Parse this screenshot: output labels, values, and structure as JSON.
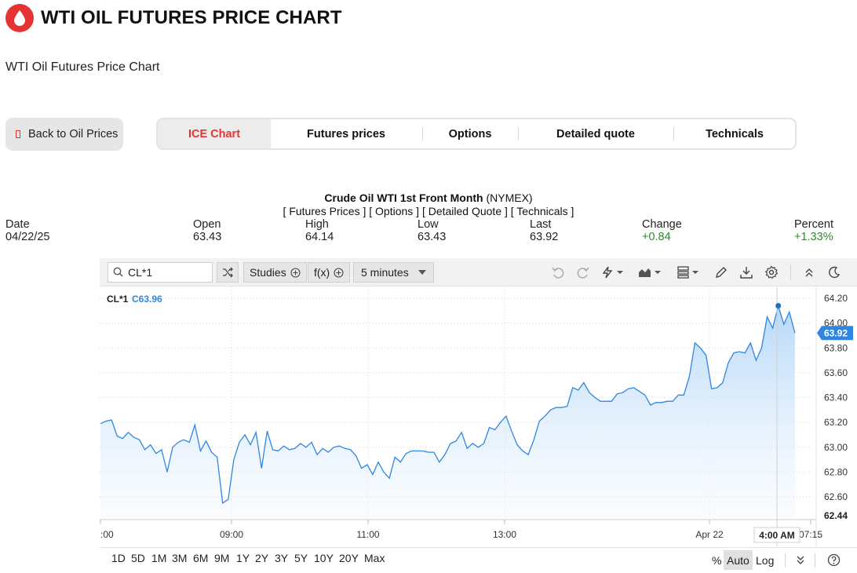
{
  "header": {
    "title": "WTI OIL FUTURES PRICE CHART",
    "subtitle": "WTI Oil Futures Price Chart",
    "brand_color": "#e53232"
  },
  "back_button": {
    "label": "Back to Oil Prices"
  },
  "tabs": [
    {
      "label": "ICE Chart",
      "active": true
    },
    {
      "label": "Futures prices",
      "active": false
    },
    {
      "label": "Options",
      "active": false
    },
    {
      "label": "Detailed quote",
      "active": false
    },
    {
      "label": "Technicals",
      "active": false
    }
  ],
  "quote": {
    "instrument": "Crude Oil WTI 1st Front Month",
    "exchange": "(NYMEX)",
    "links": "[ Futures Prices ] [ Options ] [ Detailed Quote ] [ Technicals ]",
    "columns": [
      {
        "label": "Date",
        "value": "04/22/25"
      },
      {
        "label": "Open",
        "value": "63.43"
      },
      {
        "label": "High",
        "value": "64.14"
      },
      {
        "label": "Low",
        "value": "63.43"
      },
      {
        "label": "Last",
        "value": "63.92"
      },
      {
        "label": "Change",
        "value": "+0.84"
      },
      {
        "label": "Percent",
        "value": "+1.33%"
      }
    ]
  },
  "toolbar": {
    "symbol": "CL*1",
    "studies_label": "Studies",
    "fx_label": "f(x)",
    "interval_label": "5 minutes"
  },
  "chart_data": {
    "type": "area",
    "symbol_label": "CL*1",
    "symbol_value": "C63.96",
    "last_value_label": "63.92",
    "min_label": "62.44",
    "line_color": "#2f86e0",
    "y_ticks": [
      "64.20",
      "64.00",
      "63.80",
      "63.60",
      "63.40",
      "63.20",
      "63.00",
      "62.80",
      "62.60"
    ],
    "y_tick_values": [
      64.2,
      64.0,
      63.8,
      63.6,
      63.4,
      63.2,
      63.0,
      62.8,
      62.6
    ],
    "ylim": [
      62.44,
      64.3
    ],
    "x_ticks": [
      ":00",
      "09:00",
      "11:00",
      "13:00",
      "Apr 22",
      "07:15"
    ],
    "crosshair_time": "4:00 AM",
    "series": [
      {
        "values": [
          63.19,
          63.21,
          63.22,
          63.09,
          63.07,
          63.12,
          63.08,
          63.06,
          62.98,
          63.02,
          62.95,
          62.98,
          62.8,
          63.0,
          63.04,
          63.06,
          63.04,
          63.18,
          62.97,
          63.05,
          62.96,
          62.92,
          62.55,
          62.58,
          62.9,
          63.04,
          63.1,
          63.02,
          63.12,
          62.83,
          63.13,
          62.98,
          62.97,
          63.01,
          62.98,
          62.99,
          63.03,
          63.0,
          63.04,
          62.94,
          62.99,
          62.96,
          63.0,
          63.01,
          62.99,
          62.98,
          62.93,
          62.83,
          62.86,
          62.78,
          62.88,
          62.8,
          62.75,
          62.92,
          62.88,
          62.95,
          62.97,
          62.97,
          62.97,
          62.96,
          62.96,
          62.88,
          62.94,
          63.03,
          63.05,
          63.12,
          62.99,
          63.03,
          63.0,
          63.03,
          63.16,
          63.14,
          63.2,
          63.25,
          63.13,
          63.02,
          62.97,
          62.94,
          63.06,
          63.21,
          63.25,
          63.3,
          63.32,
          63.32,
          63.33,
          63.48,
          63.46,
          63.52,
          63.44,
          63.4,
          63.37,
          63.37,
          63.37,
          63.43,
          63.44,
          63.47,
          63.48,
          63.45,
          63.42,
          63.34,
          63.36,
          63.36,
          63.37,
          63.37,
          63.42,
          63.42,
          63.57,
          63.84,
          63.8,
          63.74,
          63.47,
          63.48,
          63.52,
          63.68,
          63.76,
          63.77,
          63.76,
          63.84,
          63.7,
          63.8,
          64.05,
          63.96,
          64.14,
          63.99,
          64.09,
          63.92
        ]
      }
    ]
  },
  "ranges": [
    "1D",
    "5D",
    "1M",
    "3M",
    "6M",
    "9M",
    "1Y",
    "2Y",
    "3Y",
    "5Y",
    "10Y",
    "20Y",
    "Max"
  ],
  "scale_options": [
    "%",
    "Auto",
    "Log"
  ]
}
